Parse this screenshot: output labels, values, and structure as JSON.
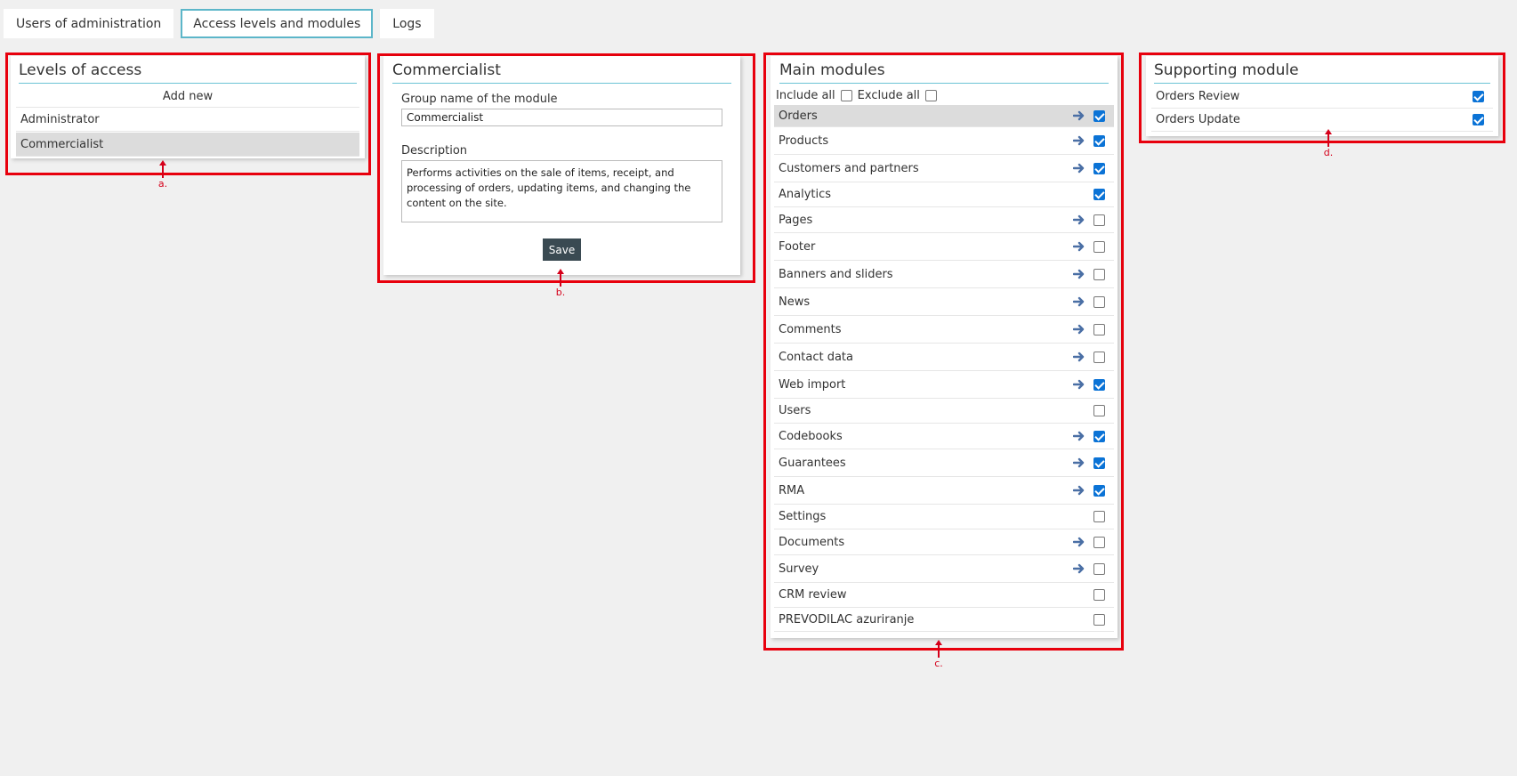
{
  "tabs": [
    {
      "label": "Users of administration",
      "active": false
    },
    {
      "label": "Access levels and modules",
      "active": true
    },
    {
      "label": "Logs",
      "active": false
    }
  ],
  "levels": {
    "title": "Levels of access",
    "add_new": "Add new",
    "items": [
      "Administrator",
      "Commercialist"
    ],
    "selected": "Commercialist"
  },
  "edit": {
    "title": "Commercialist",
    "group_label": "Group name of the module",
    "group_value": "Commercialist",
    "description_label": "Description",
    "description_value": "Performs activities on the sale of items, receipt, and processing of orders, updating items, and changing the content on the site.",
    "save_label": "Save"
  },
  "main_modules": {
    "title": "Main modules",
    "include_all": "Include all",
    "exclude_all": "Exclude all",
    "items": [
      {
        "label": "Orders",
        "arrow": true,
        "checked": true,
        "selected": true
      },
      {
        "label": "Products",
        "arrow": true,
        "checked": true
      },
      {
        "label": "Customers and partners",
        "arrow": true,
        "checked": true
      },
      {
        "label": "Analytics",
        "arrow": false,
        "checked": true
      },
      {
        "label": "Pages",
        "arrow": true,
        "checked": false
      },
      {
        "label": "Footer",
        "arrow": true,
        "checked": false
      },
      {
        "label": "Banners and sliders",
        "arrow": true,
        "checked": false
      },
      {
        "label": "News",
        "arrow": true,
        "checked": false
      },
      {
        "label": "Comments",
        "arrow": true,
        "checked": false
      },
      {
        "label": "Contact data",
        "arrow": true,
        "checked": false
      },
      {
        "label": "Web import",
        "arrow": true,
        "checked": true
      },
      {
        "label": "Users",
        "arrow": false,
        "checked": false
      },
      {
        "label": "Codebooks",
        "arrow": true,
        "checked": true
      },
      {
        "label": "Guarantees",
        "arrow": true,
        "checked": true
      },
      {
        "label": "RMA",
        "arrow": true,
        "checked": true
      },
      {
        "label": "Settings",
        "arrow": false,
        "checked": false
      },
      {
        "label": "Documents",
        "arrow": true,
        "checked": false
      },
      {
        "label": "Survey",
        "arrow": true,
        "checked": false
      },
      {
        "label": "CRM review",
        "arrow": false,
        "checked": false
      },
      {
        "label": "PREVODILAC azuriranje",
        "arrow": false,
        "checked": false
      }
    ]
  },
  "supporting": {
    "title": "Supporting module",
    "items": [
      {
        "label": "Orders Review",
        "checked": true
      },
      {
        "label": "Orders Update",
        "checked": true
      }
    ]
  },
  "markers": {
    "a": "a.",
    "b": "b.",
    "c": "c.",
    "d": "d."
  },
  "colors": {
    "annotation": "#e8000d",
    "accent": "#5cb6c9",
    "checkbox": "#0b73d6",
    "arrow": "#4a6fa5"
  }
}
